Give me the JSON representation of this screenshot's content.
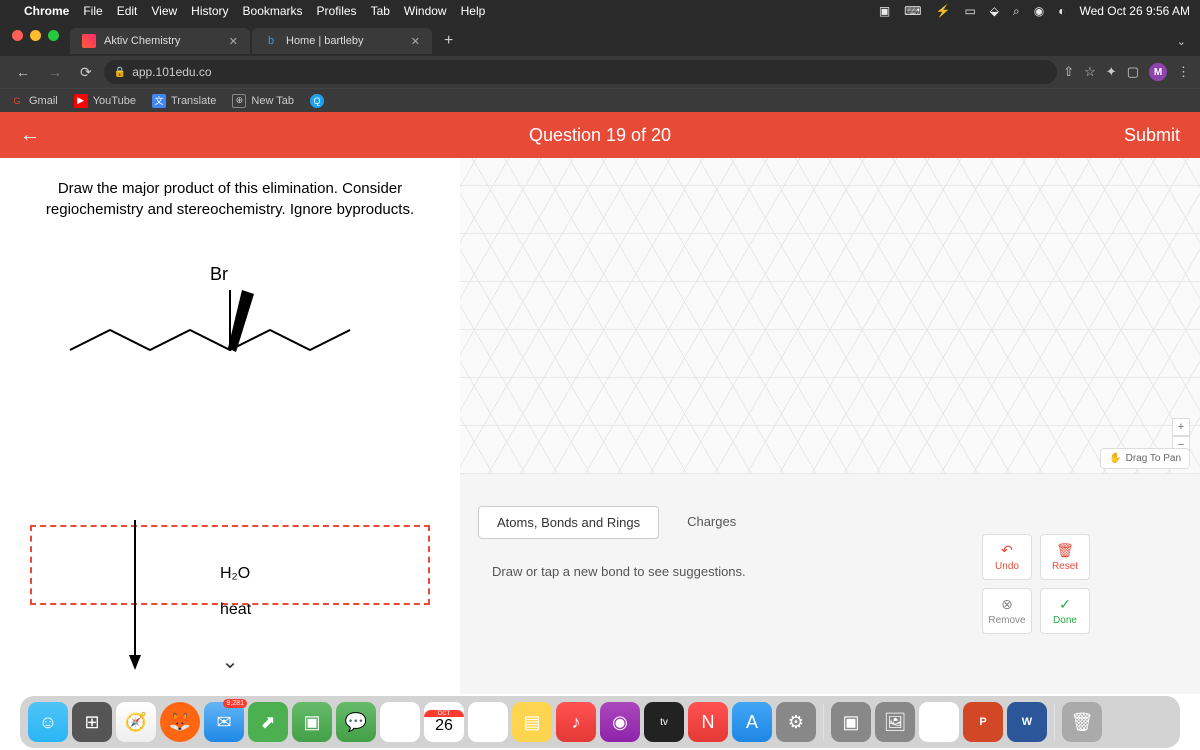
{
  "menubar": {
    "app": "Chrome",
    "items": [
      "File",
      "Edit",
      "View",
      "History",
      "Bookmarks",
      "Profiles",
      "Tab",
      "Window",
      "Help"
    ],
    "datetime": "Wed Oct 26 9:56 AM"
  },
  "tabs": [
    {
      "title": "Aktiv Chemistry",
      "active": true
    },
    {
      "title": "Home | bartleby",
      "active": false
    }
  ],
  "url": "app.101edu.co",
  "profile_letter": "M",
  "bookmarks": [
    {
      "label": "Gmail"
    },
    {
      "label": "YouTube"
    },
    {
      "label": "Translate"
    },
    {
      "label": "New Tab"
    }
  ],
  "header": {
    "question_counter": "Question 19 of 20",
    "submit": "Submit"
  },
  "question": {
    "prompt": "Draw the major product of this elimination. Consider regiochemistry and stereochemistry. Ignore byproducts.",
    "atom_label_br": "Br",
    "reagent1": "H₂O",
    "reagent2": "heat"
  },
  "canvas": {
    "drag_pan": "Drag To Pan",
    "zoom_in": "+",
    "zoom_out": "−",
    "tab1": "Atoms, Bonds and Rings",
    "tab2": "Charges",
    "hint": "Draw or tap a new bond to see suggestions.",
    "actions": {
      "undo": "Undo",
      "reset": "Reset",
      "remove": "Remove",
      "done": "Done"
    }
  },
  "dock": {
    "mail_badge": "9,281",
    "cal_month": "OCT",
    "cal_day": "26",
    "tv_label": "tv",
    "ppt": "P",
    "word": "W"
  }
}
